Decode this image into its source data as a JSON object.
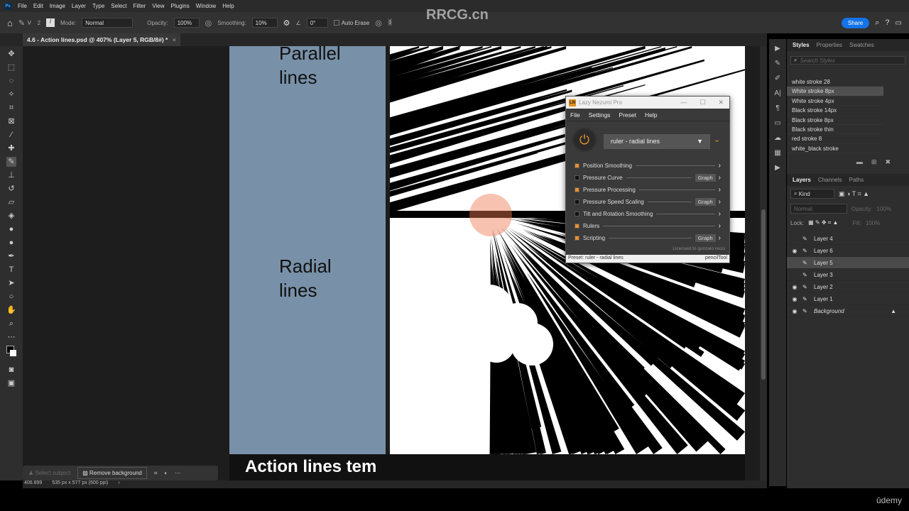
{
  "app": {
    "logo": "Ps",
    "menu": [
      "File",
      "Edit",
      "Image",
      "Layer",
      "Type",
      "Select",
      "Filter",
      "View",
      "Plugins",
      "Window",
      "Help"
    ]
  },
  "options": {
    "brush_size": "2",
    "mode_label": "Mode:",
    "mode": "Normal",
    "opacity_label": "Opacity:",
    "opacity": "100%",
    "smoothing_label": "Smoothing:",
    "smoothing": "10%",
    "angle": "0°",
    "auto_erase": "Auto Erase",
    "share": "Share"
  },
  "document": {
    "tab": "4.6 - Action lines.psd @ 407% (Layer 5, RGB/8#) *",
    "close": "×"
  },
  "canvas": {
    "heading1": "Parallel\nlines",
    "heading2": "Radial\nlines",
    "caption": "Action lines tem"
  },
  "styles": {
    "tabs": [
      "Styles",
      "Properties",
      "Swatches"
    ],
    "search_placeholder": "Search Styles",
    "items": [
      "white stroke 28",
      "White stroke 8px",
      "White stroke 4px",
      "Black stroke 14px",
      "Black stroke 8px",
      "Black stroke thin",
      "red stroke 8",
      "white_black stroke"
    ],
    "selected": "White stroke 8px"
  },
  "layers": {
    "tabs": [
      "Layers",
      "Channels",
      "Paths"
    ],
    "filter": "Kind",
    "blend": "Normal",
    "opacity_label": "Opacity:",
    "opacity": "100%",
    "lock_label": "Lock:",
    "fill_label": "Fill:",
    "fill": "100%",
    "items": [
      {
        "name": "Layer 4",
        "visible": false
      },
      {
        "name": "Layer 6",
        "visible": true
      },
      {
        "name": "Layer 5",
        "visible": false,
        "selected": true
      },
      {
        "name": "Layer 3",
        "visible": false
      },
      {
        "name": "Layer 2",
        "visible": true
      },
      {
        "name": "Layer 1",
        "visible": true
      },
      {
        "name": "Background",
        "visible": true,
        "locked": true
      }
    ]
  },
  "lazy_nezumi": {
    "title": "Lazy Nezumi Pro",
    "logo": "LN",
    "menu": [
      "File",
      "Settings",
      "Preset",
      "Help"
    ],
    "preset": "ruler - radial lines",
    "options": [
      {
        "label": "Position Smoothing",
        "on": true,
        "graph": false
      },
      {
        "label": "Pressure Curve",
        "on": false,
        "graph": true
      },
      {
        "label": "Pressure Processing",
        "on": true,
        "graph": false
      },
      {
        "label": "Pressure Speed Scaling",
        "on": false,
        "graph": true
      },
      {
        "label": "Tilt and Rotation Smoothing",
        "on": false,
        "graph": false
      },
      {
        "label": "Rulers",
        "on": true,
        "graph": false
      },
      {
        "label": "Scripting",
        "on": true,
        "graph": true
      }
    ],
    "graph_label": "Graph",
    "license": "Licensed to gonzalo recio",
    "status_preset": "Preset: ruler - radial lines",
    "status_tool": "pencilTool",
    "accent": "#e8902a"
  },
  "contextbar": {
    "select_subject": "Select subject",
    "remove_background": "Remove background"
  },
  "status": {
    "zoom": "406.899",
    "size": "535 px x 577 px (600 ppi)"
  },
  "watermark": "RRCG.cn",
  "footer": {
    "brand": "ūdemy"
  }
}
